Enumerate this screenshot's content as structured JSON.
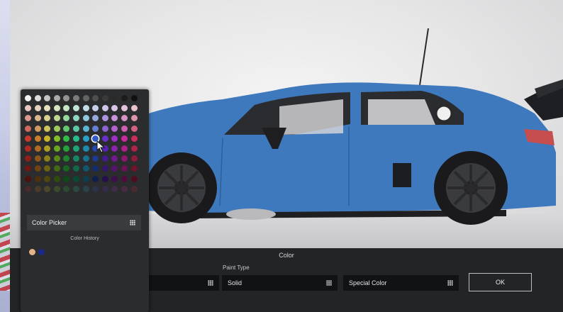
{
  "color_panel": {
    "title": "Color",
    "paint_type_label": "Paint Type",
    "field_left_value": "",
    "paint_type_value": "Solid",
    "special_color_label": "Special Color",
    "ok_label": "OK"
  },
  "picker": {
    "button_label": "Color Picker",
    "history_label": "Color History",
    "history": [
      "#e3b48a",
      "#1a2a8a"
    ],
    "selected": {
      "row": 4,
      "col": 7
    },
    "palette": [
      [
        "#f2f2f2",
        "#dcdcdc",
        "#c4c4c4",
        "#ababab",
        "#939393",
        "#7b7b7b",
        "#646464",
        "#4e4e4e",
        "#3a3a3a",
        "#2a2a2a",
        "#1c1c1c",
        "#111111"
      ],
      [
        "#e9c7c2",
        "#e7d2bf",
        "#e6e0bf",
        "#d7e6c0",
        "#c6e6c5",
        "#c2e4d9",
        "#c2dde6",
        "#c5cfe8",
        "#cfc6e8",
        "#dcc4e6",
        "#e6c3dc",
        "#e9c3cd"
      ],
      [
        "#db9a90",
        "#dbb590",
        "#d8d190",
        "#bcd98f",
        "#98d99e",
        "#8fd7c0",
        "#8fc9db",
        "#95a9dd",
        "#ac95de",
        "#c993dc",
        "#d992c6",
        "#dc94a8"
      ],
      [
        "#d06a60",
        "#d09a60",
        "#cdc45e",
        "#9fcb5e",
        "#62c970",
        "#5dc8a6",
        "#5db4d0",
        "#647fd2",
        "#8b63d3",
        "#b461d1",
        "#cf5fb2",
        "#d16281"
      ],
      [
        "#c9382d",
        "#c97e2d",
        "#c8b52b",
        "#82c12b",
        "#33bb47",
        "#2bba8b",
        "#2aa0c6",
        "#325bc7",
        "#6a31c8",
        "#9f2fc6",
        "#c62c9e",
        "#c82f5a"
      ],
      [
        "#b02a21",
        "#b06b21",
        "#ae9e1f",
        "#6ca720",
        "#26a23a",
        "#20a277",
        "#1f89ae",
        "#2648af",
        "#5625b0",
        "#8a23ae",
        "#ad2089",
        "#af2349"
      ],
      [
        "#8f2019",
        "#8f5619",
        "#8e8018",
        "#578818",
        "#1d842d",
        "#188460",
        "#17708e",
        "#1d3a8f",
        "#451c8f",
        "#701a8e",
        "#8d1870",
        "#8f1b3b"
      ],
      [
        "#6e1813",
        "#6e4213",
        "#6d6212",
        "#436912",
        "#166622",
        "#12664a",
        "#11566d",
        "#162c6e",
        "#35156e",
        "#56146d",
        "#6c1256",
        "#6e142d"
      ],
      [
        "#4f110d",
        "#4f2f0d",
        "#4e460c",
        "#304b0c",
        "#0f4918",
        "#0c4935",
        "#0c3e4e",
        "#0f1f4f",
        "#260f4f",
        "#3e0e4e",
        "#4e0d3e",
        "#4f0e20"
      ],
      [
        "#4a2a29",
        "#4a3a2a",
        "#4a472a",
        "#3c4a2a",
        "#2c4a30",
        "#2a4a40",
        "#2a424a",
        "#2b334a",
        "#352b4a",
        "#422a4a",
        "#4a2a42",
        "#4a2a33"
      ]
    ]
  }
}
